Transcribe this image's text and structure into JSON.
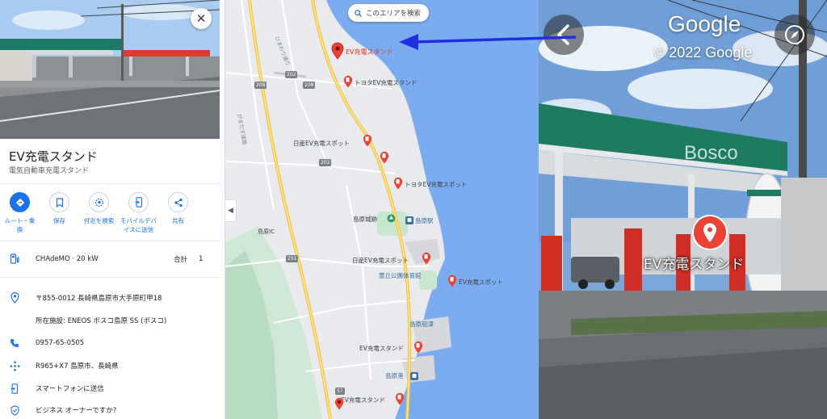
{
  "panel": {
    "close_label": "✕",
    "title": "EV充電スタンド",
    "subtitle": "電気自動車充電スタンド",
    "actions": [
      {
        "label_line1": "ルート・乗",
        "label_line2": "換",
        "icon": "directions-icon"
      },
      {
        "label_line1": "保存",
        "label_line2": "",
        "icon": "bookmark-icon"
      },
      {
        "label_line1": "付近を検索",
        "label_line2": "",
        "icon": "nearby-icon"
      },
      {
        "label_line1": "モバイルデバ",
        "label_line2": "イスに送信",
        "icon": "send-to-phone-icon"
      },
      {
        "label_line1": "共有",
        "label_line2": "",
        "icon": "share-icon"
      }
    ],
    "charger": {
      "type": "CHAdeMO",
      "sep": "·",
      "power": "20 kW",
      "total_label": "合計",
      "total_count": "1"
    },
    "info": {
      "address": "〒855-0012 長崎県島原市大手原町甲18",
      "located_in": "所在施設: ENEOS ボスコ島原 SS (ボスコ)",
      "phone": "0957-65-0505",
      "plus_code": "R965+X7 島原市、長崎県",
      "send_to_phone": "スマートフォンに送信",
      "claim_business": "ビジネス オーナーですか?"
    }
  },
  "map": {
    "search_button": "このエリアを検索",
    "places": [
      {
        "name": "EV充電スタンド",
        "kind": "selected"
      },
      {
        "name": "トヨタEV充電スタンド",
        "kind": "pin"
      },
      {
        "name": "日産EV充電スポット",
        "kind": "pin"
      },
      {
        "name": "トヨタEV充電スポット",
        "kind": "pin"
      },
      {
        "name": "日産EV充電スポット",
        "kind": "pin"
      },
      {
        "name": "EV充電スポット",
        "kind": "pin"
      },
      {
        "name": "EV充電スタンド",
        "kind": "pin"
      },
      {
        "name": "EV充電スタンド",
        "kind": "pin"
      }
    ],
    "labels": {
      "castle": "島原城跡",
      "station1": "島原駅",
      "gym": "霊丘公園体育館",
      "station2": "島原船津",
      "port": "島原港",
      "ic": "島原IC",
      "road_a": "ひまわり通り",
      "road_b": "がまだす道路",
      "edge": "三"
    },
    "route_numbers": [
      "208",
      "202",
      "208",
      "202",
      "251",
      "57"
    ]
  },
  "street_view": {
    "logo": "Google",
    "copyright": "© 2022 Google",
    "sign": "Bosco",
    "place_label": "EV充電スタンド"
  },
  "colors": {
    "accent_blue": "#1a73e8",
    "pin_red": "#ea4335",
    "annotation_arrow": "#1f2fe0"
  }
}
